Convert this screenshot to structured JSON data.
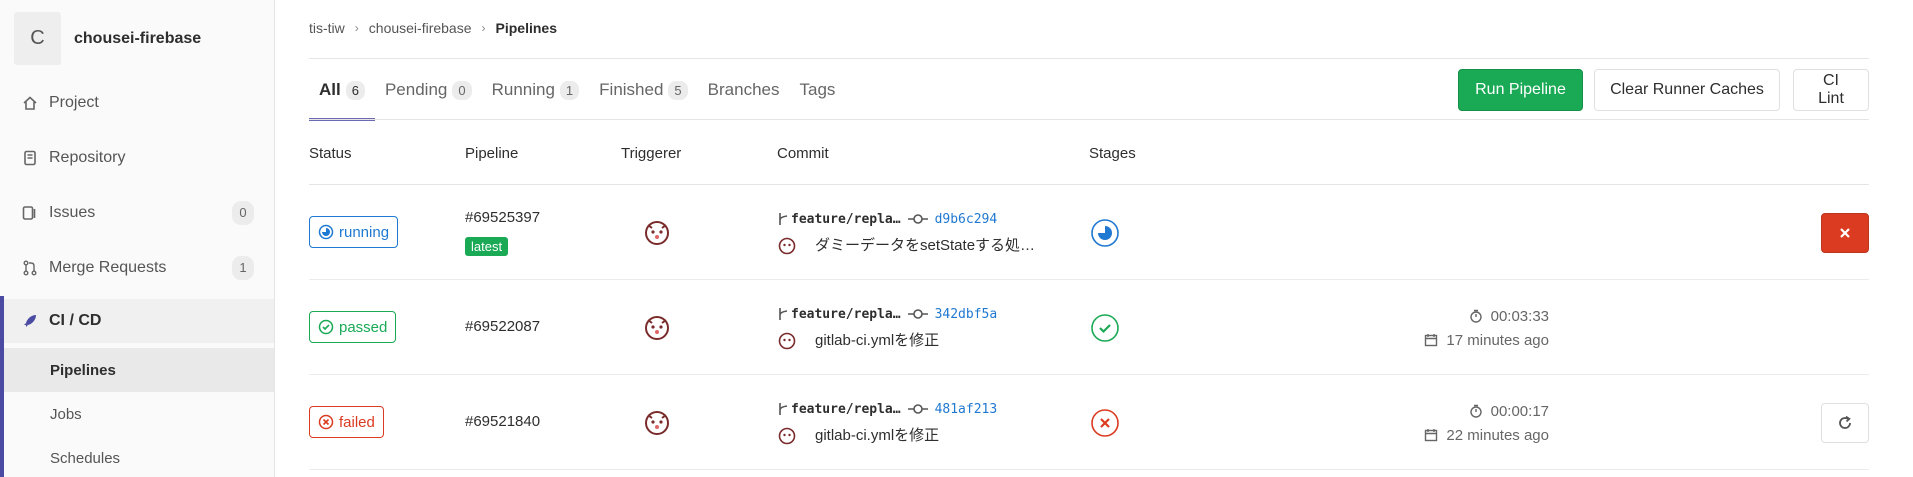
{
  "project": {
    "avatar_letter": "C",
    "name": "chousei-firebase"
  },
  "sidebar": {
    "items": [
      {
        "label": "Project",
        "icon": "home-icon"
      },
      {
        "label": "Repository",
        "icon": "doc-icon"
      },
      {
        "label": "Issues",
        "icon": "issues-icon",
        "count": "0"
      },
      {
        "label": "Merge Requests",
        "icon": "merge-icon",
        "count": "1"
      },
      {
        "label": "CI / CD",
        "icon": "rocket-icon"
      }
    ],
    "sub_items": [
      {
        "label": "Pipelines"
      },
      {
        "label": "Jobs"
      },
      {
        "label": "Schedules"
      }
    ]
  },
  "breadcrumb": {
    "group": "tis-tiw",
    "project": "chousei-firebase",
    "current": "Pipelines"
  },
  "tabs": [
    {
      "label": "All",
      "count": "6"
    },
    {
      "label": "Pending",
      "count": "0"
    },
    {
      "label": "Running",
      "count": "1"
    },
    {
      "label": "Finished",
      "count": "5"
    },
    {
      "label": "Branches"
    },
    {
      "label": "Tags"
    }
  ],
  "buttons": {
    "run_pipeline": "Run Pipeline",
    "clear_caches": "Clear Runner Caches",
    "ci_lint": "CI Lint"
  },
  "table": {
    "headers": {
      "status": "Status",
      "pipeline": "Pipeline",
      "triggerer": "Triggerer",
      "commit": "Commit",
      "stages": "Stages"
    },
    "rows": [
      {
        "status": "running",
        "pipeline_id": "#69525397",
        "badge": "latest",
        "branch": "feature/repla…",
        "sha": "d9b6c294",
        "message": "ダミーデータをsetStateする処…",
        "duration": "",
        "finished": "",
        "action": "cancel"
      },
      {
        "status": "passed",
        "pipeline_id": "#69522087",
        "branch": "feature/repla…",
        "sha": "342dbf5a",
        "message": "gitlab-ci.ymlを修正",
        "duration": "00:03:33",
        "finished": "17 minutes ago",
        "action": ""
      },
      {
        "status": "failed",
        "pipeline_id": "#69521840",
        "branch": "feature/repla…",
        "sha": "481af213",
        "message": "gitlab-ci.ymlを修正",
        "duration": "00:00:17",
        "finished": "22 minutes ago",
        "action": "retry"
      }
    ]
  },
  "colors": {
    "running": "#1f78d1",
    "passed": "#1aaa55",
    "failed": "#db3b21",
    "accent": "#4b4ba3"
  }
}
